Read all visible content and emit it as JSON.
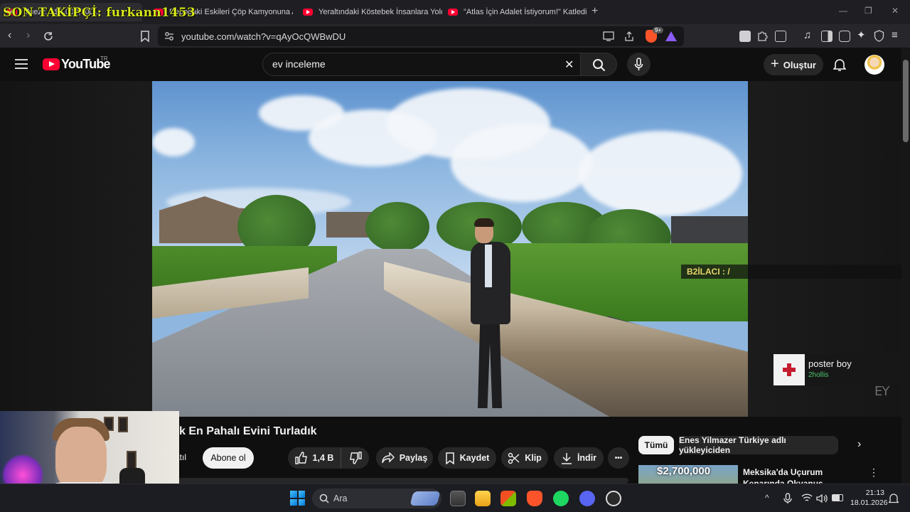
{
  "stream_overlay": {
    "follower_text": "SON TAKİPÇİ: furkann1453"
  },
  "browser": {
    "tabs": [
      {
        "label": "Muezz... $2,000,000..."
      },
      {
        "label": "Depodaki Eskileri Çöp Kamyonuna At"
      },
      {
        "label": "Yeraltındaki Köstebek İnsanlara Yolcu"
      },
      {
        "label": "\"Atlas İçin Adalet İstiyorum!\" Katledil"
      }
    ],
    "new_tab": "+",
    "url": "youtube.com/watch?v=qAyOcQWBwDU",
    "brave_badge": "9+",
    "window_controls": {
      "minimize": "—",
      "maximize": "❐",
      "close": "✕"
    }
  },
  "youtube": {
    "logo_text": "YouTube",
    "country_code": "TR",
    "search_value": "ev inceleme",
    "clear_icon": "✕",
    "create_label": "Oluştur",
    "create_plus": "+",
    "video": {
      "title": "k En Pahalı Evini Turladık",
      "joined_label": "atıl",
      "subscribe_label": "Abone ol",
      "like_count": "1,4 B",
      "share_label": "Paylaş",
      "save_label": "Kaydet",
      "clip_label": "Klip",
      "download_label": "İndir",
      "more_label": "•••"
    },
    "chips": {
      "all": "Tümü",
      "uploader": "Enes Yilmazer Türkiye adlı yükleyiciden",
      "next": "›"
    },
    "recommendation": {
      "thumb_price": "$2,700,000",
      "title": "Meksika'da Uçurum Kenarında Okyanus Manzaralı İnanılmaz",
      "menu": "⋮"
    }
  },
  "stream_widgets": {
    "b2_label": "B2İLACI : /",
    "song_title": "poster boy",
    "song_artist": "2hollis",
    "watermark": "EY"
  },
  "taskbar": {
    "search_placeholder": "Ara",
    "time": "21:13",
    "date": "18.01.2026",
    "tray_chevron": "^"
  },
  "colors": {
    "accent_red": "#ff0033",
    "follower_text": "#d7e81c",
    "song_artist": "#4ac56b",
    "b2_label": "#e7d66a"
  }
}
